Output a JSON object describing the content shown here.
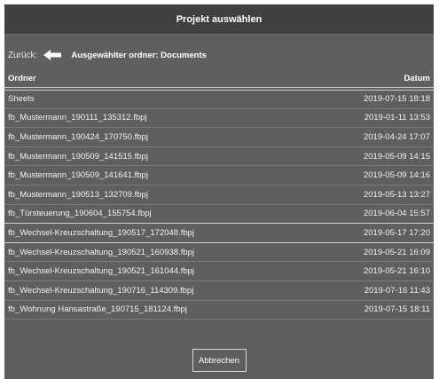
{
  "dialog": {
    "title": "Projekt auswählen",
    "back_label": "Zurück:",
    "back_icon": "arrow-left-icon",
    "selected_folder": "Ausgewählter ordner: Documents",
    "columns": {
      "name": "Ordner",
      "date": "Datum"
    },
    "rows": [
      {
        "name": "Sheets",
        "date": "2019-07-15 18:18"
      },
      {
        "name": "fb_Mustermann_190111_135312.fbpj",
        "date": "2019-01-11 13:53"
      },
      {
        "name": "fb_Mustermann_190424_170750.fbpj",
        "date": "2019-04-24 17:07"
      },
      {
        "name": "fb_Mustermann_190509_141515.fbpj",
        "date": "2019-05-09 14:15"
      },
      {
        "name": "fb_Mustermann_190509_141641.fbpj",
        "date": "2019-05-09 14:16"
      },
      {
        "name": "fb_Mustermann_190513_132709.fbpj",
        "date": "2019-05-13 13:27"
      },
      {
        "name": "fb_Türsteuerung_190604_155754.fbpj",
        "date": "2019-06-04 15:57"
      },
      {
        "name": "fb_Wechsel-Kreuzschaltung_190517_172048.fbpj",
        "date": "2019-05-17 17:20"
      },
      {
        "name": "fb_Wechsel-Kreuzschaltung_190521_160938.fbpj",
        "date": "2019-05-21 16:09"
      },
      {
        "name": "fb_Wechsel-Kreuzschaltung_190521_161044.fbpj",
        "date": "2019-05-21 16:10"
      },
      {
        "name": "fb_Wechsel-Kreuzschaltung_190716_114309.fbpj",
        "date": "2019-07-16 11:43"
      },
      {
        "name": "fb_Wohnung Hansastraße_190715_181124.fbpj",
        "date": "2019-07-15 18:11"
      }
    ],
    "cancel_label": "Abbrechen"
  },
  "colors": {
    "dialog_bg": "#5f5f5f",
    "title_bg": "#404040",
    "text": "#f2f2f2",
    "separator_light": "#d0d0d0",
    "separator_dark": "#7a7a7a"
  }
}
